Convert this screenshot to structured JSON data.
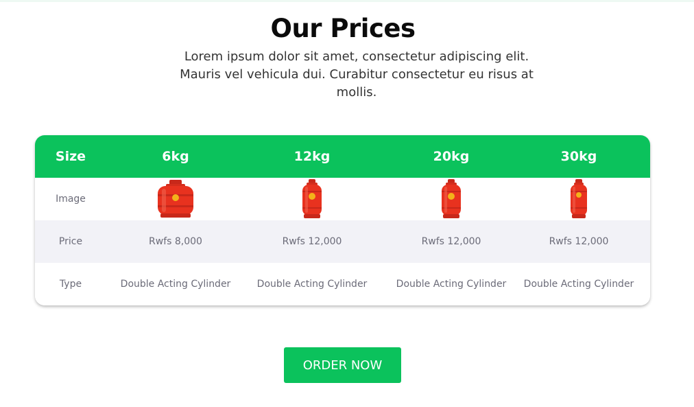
{
  "section": {
    "title": "Our Prices",
    "description": "Lorem ipsum dolor sit amet, consectetur adipiscing elit. Mauris vel vehicula dui. Curabitur consectetur eu risus at mollis."
  },
  "table": {
    "header": {
      "row_label": "Size",
      "columns": [
        "6kg",
        "12kg",
        "20kg",
        "30kg"
      ]
    },
    "rows": {
      "image": {
        "label": "Image",
        "icons": [
          "gas-cylinder-icon",
          "gas-cylinder-icon",
          "gas-cylinder-icon",
          "gas-cylinder-icon"
        ]
      },
      "price": {
        "label": "Price",
        "values": [
          "Rwfs 8,000",
          "Rwfs 12,000",
          "Rwfs 12,000",
          "Rwfs 12,000"
        ]
      },
      "type": {
        "label": "Type",
        "values": [
          "Double Acting Cylinder",
          "Double Acting Cylinder",
          "Double Acting Cylinder",
          "Double Acting Cylinder"
        ]
      }
    }
  },
  "cta": {
    "label": "ORDER NOW"
  },
  "colors": {
    "brand_green": "#0bc25c",
    "cylinder_red": "#e8321f",
    "cylinder_logo": "#f3b21a",
    "row_alt": "#f2f2f7",
    "text_muted": "#6b6b78"
  }
}
